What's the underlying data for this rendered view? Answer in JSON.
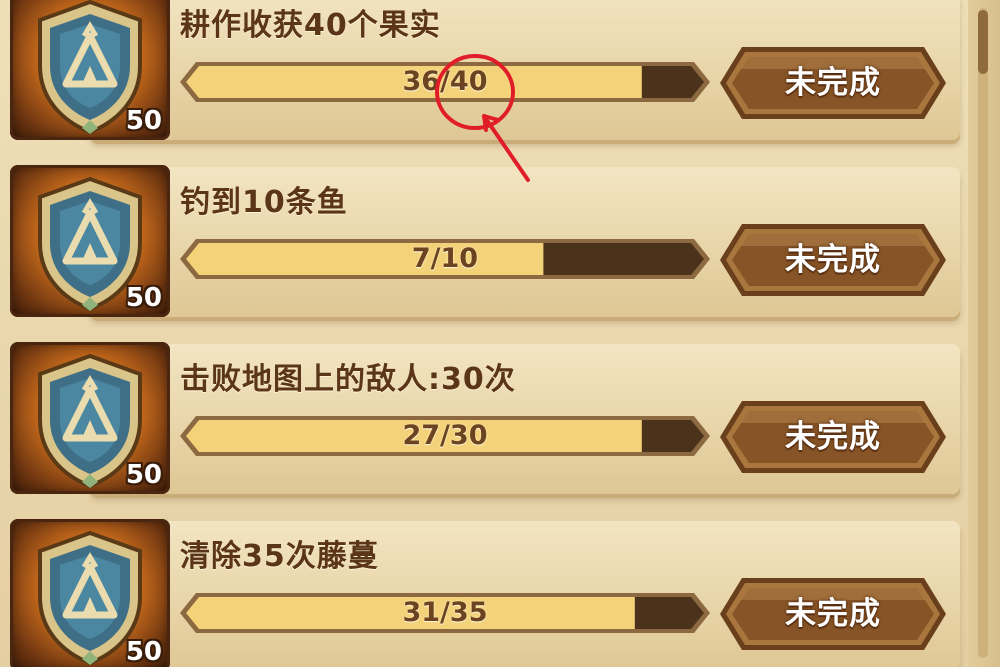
{
  "tasks": [
    {
      "title": "耕作收获40个果实",
      "progress_text": "36/40",
      "current": 36,
      "target": 40,
      "level": "50",
      "status": "未完成"
    },
    {
      "title": "钓到10条鱼",
      "progress_text": "7/10",
      "current": 7,
      "target": 10,
      "level": "50",
      "status": "未完成"
    },
    {
      "title": "击败地图上的敌人:30次",
      "progress_text": "27/30",
      "current": 27,
      "target": 30,
      "level": "50",
      "status": "未完成"
    },
    {
      "title": "清除35次藤蔓",
      "progress_text": "31/35",
      "current": 31,
      "target": 35,
      "level": "50",
      "status": "未完成"
    }
  ],
  "icons": {
    "badge": "tent-shield-icon",
    "annotation": "red-circle-arrow"
  },
  "colors": {
    "progress_fill": "#f3d27a",
    "progress_empty": "#4a331a",
    "button_body": "#8a5a31",
    "annotation": "#e11d2a"
  }
}
